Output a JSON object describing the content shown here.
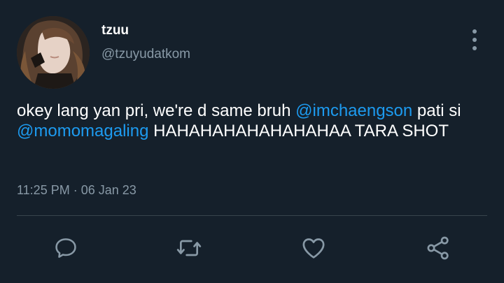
{
  "tweet": {
    "display_name": "tzuu",
    "handle": "@tzuyudatkom",
    "text_parts": [
      "okey lang yan pri, we're d same bruh ",
      "@imchaengson",
      " pati si ",
      "@momomagaling",
      " HAHAHAHAHAHAHAHAA TARA SHOT"
    ],
    "timestamp": "11:25 PM · 06 Jan 23"
  },
  "actions": {
    "reply_icon": "speech-bubble-icon",
    "retweet_icon": "retweet-icon",
    "like_icon": "heart-icon",
    "share_icon": "share-icon"
  },
  "colors": {
    "background": "#15202b",
    "text": "#ffffff",
    "secondary": "#8899a6",
    "accent": "#1d9bf0",
    "divider": "#38444d"
  }
}
